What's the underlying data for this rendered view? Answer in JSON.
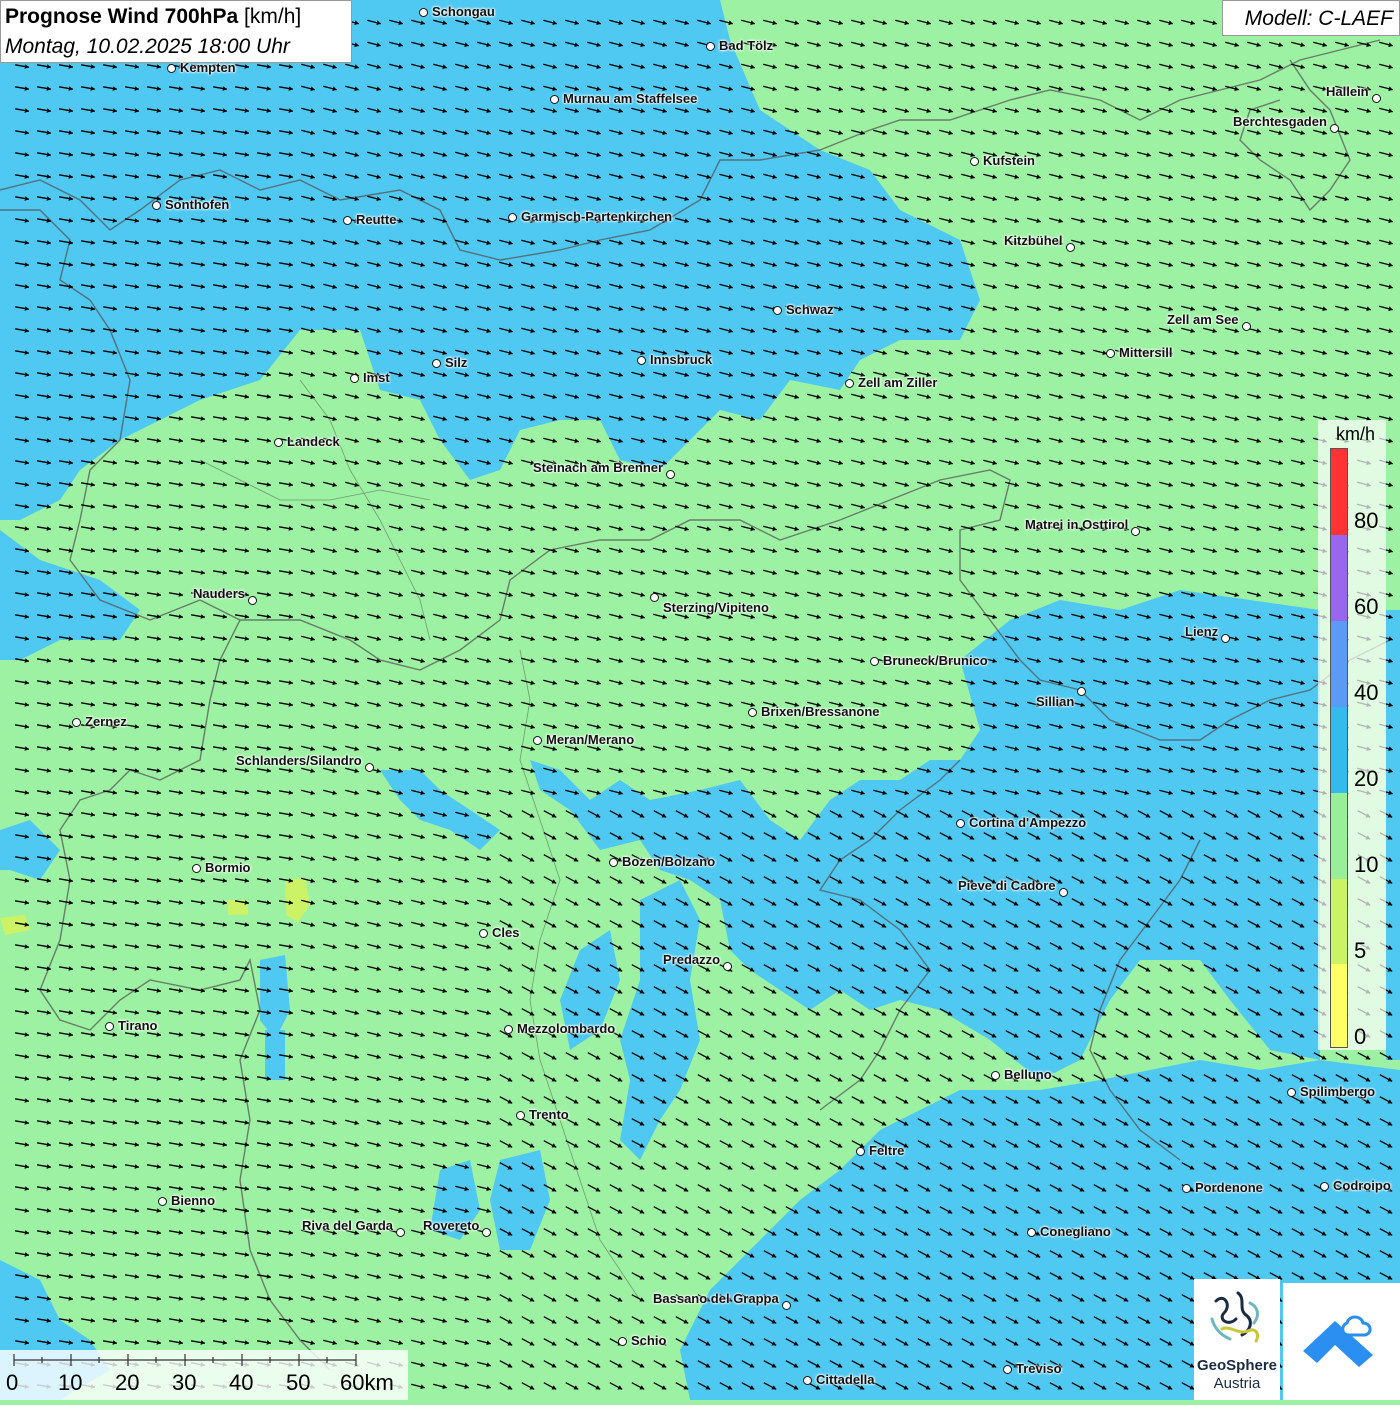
{
  "header": {
    "title": "Prognose Wind 700hPa",
    "unit": "[km/h]",
    "datetime": "Montag, 10.02.2025 18:00 Uhr"
  },
  "model": {
    "label": "Modell: C-LAEF"
  },
  "legend": {
    "unit": "km/h",
    "labels": [
      "80",
      "60",
      "40",
      "20",
      "10",
      "5",
      "0"
    ],
    "colors": [
      "#ff3333",
      "#9966ee",
      "#5b9af5",
      "#33bbee",
      "#99ee99",
      "#ccf266",
      "#ffff66"
    ]
  },
  "scale": {
    "labels": [
      "0",
      "10",
      "20",
      "30",
      "40",
      "50",
      "60km"
    ]
  },
  "logos": {
    "geosphere_line1": "GeoSphere",
    "geosphere_line2": "Austria"
  },
  "map_colors": {
    "wind_10_20": "#9cf2a2",
    "wind_20_40": "#4fc8f2",
    "background": "#9cf2a2"
  },
  "cities": [
    "Schongau",
    "Bad Tölz",
    "Kempten",
    "Murnau am Staffelsee",
    "Hallein",
    "Berchtesgaden",
    "Kufstein",
    "Sonthofen",
    "Reutte",
    "Garmisch-Partenkirchen",
    "Kitzbühel",
    "Schwaz",
    "Zell am See",
    "Mittersill",
    "Innsbruck",
    "Silz",
    "Imst",
    "Zell am Ziller",
    "Landeck",
    "Steinach am Brenner",
    "Matrei in Osttirol",
    "Nauders",
    "Sterzing/Vipiteno",
    "Lienz",
    "Bruneck/Brunico",
    "Sillian",
    "Zernez",
    "Brixen/Bressanone",
    "Meran/Merano",
    "Schlanders/Silandro",
    "Cortina d'Ampezzo",
    "Bormio",
    "Bozen/Bolzano",
    "Pieve di Cadore",
    "Cles",
    "Predazzo",
    "Tirano",
    "Mezzolombardo",
    "Belluno",
    "Spilimbergo",
    "Trento",
    "Feltre",
    "Pordenone",
    "Codroipo",
    "Bienno",
    "Riva del Garda",
    "Rovereto",
    "Conegliano",
    "Bassano del Grappa",
    "Schio",
    "Treviso",
    "Cittadella"
  ]
}
